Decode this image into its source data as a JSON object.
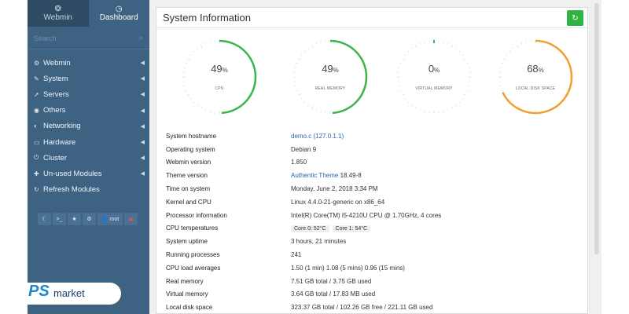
{
  "sidebar": {
    "tabs": [
      {
        "label": "Webmin",
        "icon": "webmin-logo-icon"
      },
      {
        "label": "Dashboard",
        "icon": "dashboard-icon"
      }
    ],
    "search_placeholder": "Search",
    "items": [
      {
        "label": "Webmin",
        "icon": "gear-icon"
      },
      {
        "label": "System",
        "icon": "wrench-icon"
      },
      {
        "label": "Servers",
        "icon": "rocket-icon"
      },
      {
        "label": "Others",
        "icon": "globe-icon"
      },
      {
        "label": "Networking",
        "icon": "shield-icon"
      },
      {
        "label": "Hardware",
        "icon": "drive-icon"
      },
      {
        "label": "Cluster",
        "icon": "power-icon"
      },
      {
        "label": "Un-used Modules",
        "icon": "puzzle-icon"
      },
      {
        "label": "Refresh Modules",
        "icon": "refresh-icon"
      }
    ],
    "bottom": {
      "user": "root"
    }
  },
  "panel": {
    "title": "System Information",
    "gauges": [
      {
        "value": "49",
        "unit": "%",
        "label": "CPU",
        "percent": 49,
        "color": "#3cb44b"
      },
      {
        "value": "49",
        "unit": "%",
        "label": "REAL MEMORY",
        "percent": 49,
        "color": "#3cb44b"
      },
      {
        "value": "0",
        "unit": "%",
        "label": "VIRTUAL MEMORY",
        "percent": 0,
        "color": "#3cb44b"
      },
      {
        "value": "68",
        "unit": "%",
        "label": "LOCAL DISK SPACE",
        "percent": 68,
        "color": "#f0a030"
      }
    ],
    "info": {
      "hostname": {
        "key": "System hostname",
        "value": "demo.c",
        "extra": "(127.0.1.1)"
      },
      "os": {
        "key": "Operating system",
        "value": "Debian 9"
      },
      "webmin": {
        "key": "Webmin version",
        "value": "1.850"
      },
      "theme": {
        "key": "Theme version",
        "value": "Authentic Theme",
        "extra": "18.49-8"
      },
      "time": {
        "key": "Time on system",
        "value": "Monday, June 2, 2018 3:34 PM"
      },
      "kernel": {
        "key": "Kernel and CPU",
        "value": "Linux 4.4.0-21-generic on x86_64"
      },
      "processor": {
        "key": "Processor information",
        "value": "Intel(R) Core(TM) i5-4210U CPU @ 1.70GHz, 4 cores"
      },
      "temps": {
        "key": "CPU temperatures",
        "core0": "Core 0: 52°C",
        "core1": "Core 1: 54°C"
      },
      "uptime": {
        "key": "System uptime",
        "value": "3 hours, 21 minutes"
      },
      "procs": {
        "key": "Running processes",
        "value": "241"
      },
      "load": {
        "key": "CPU load averages",
        "value": "1.50 (1 min) 1.08 (5 mins) 0.96 (15 mins)"
      },
      "realmem": {
        "key": "Real memory",
        "value": "7.51 GB total / 3.75 GB used"
      },
      "virtmem": {
        "key": "Virtual memory",
        "value": "3.64 GB total / 17.83 MB used"
      },
      "disk": {
        "key": "Local disk space",
        "value": "323.37 GB total / 102.26 GB free / 221.11 GB used"
      }
    }
  },
  "watermark": {
    "brand": "PS",
    "text": "market"
  }
}
